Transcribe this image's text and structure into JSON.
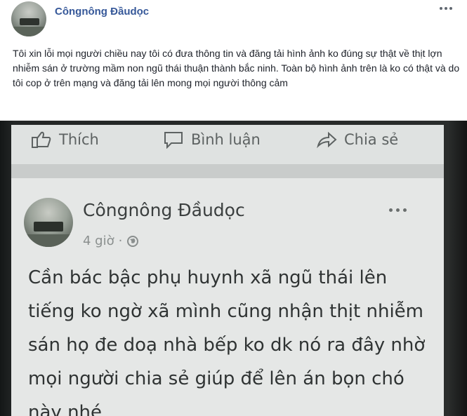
{
  "post": {
    "author": "Côngnông Đầudọc",
    "text": "Tôi xin lỗi mọi người chiều nay tôi có đưa thông tin và đăng tải hình ảnh ko đúng sự thật về thịt lợn nhiễm sán ở trường mầm non ngũ thái thuận thành bắc ninh. Toàn bộ hình ảnh trên là ko có thật và do tôi cop ở trên mạng và đăng tải lên mong mọi người thông cảm"
  },
  "screenshot": {
    "actions": {
      "like": "Thích",
      "comment": "Bình luận",
      "share": "Chia sẻ"
    },
    "inner_post": {
      "author": "Côngnông Đầudọc",
      "time": "4 giờ",
      "separator": "·",
      "text": "Cần bác bậc phụ huynh xã ngũ thái lên tiếng ko ngờ xã mình cũng nhận thịt nhiễm sán họ đe doạ nhà bếp ko dk nó ra đây nhờ mọi người chia sẻ giúp để lên án bọn chó này nhé"
    }
  },
  "icons": {
    "more": "more-options-icon",
    "privacy": "globe-icon",
    "like": "thumbs-up-icon",
    "comment": "comment-icon",
    "share": "share-icon"
  },
  "colors": {
    "author_link": "#365899",
    "screen_bg": "#e5e7e6",
    "photo_frame": "#232626"
  }
}
